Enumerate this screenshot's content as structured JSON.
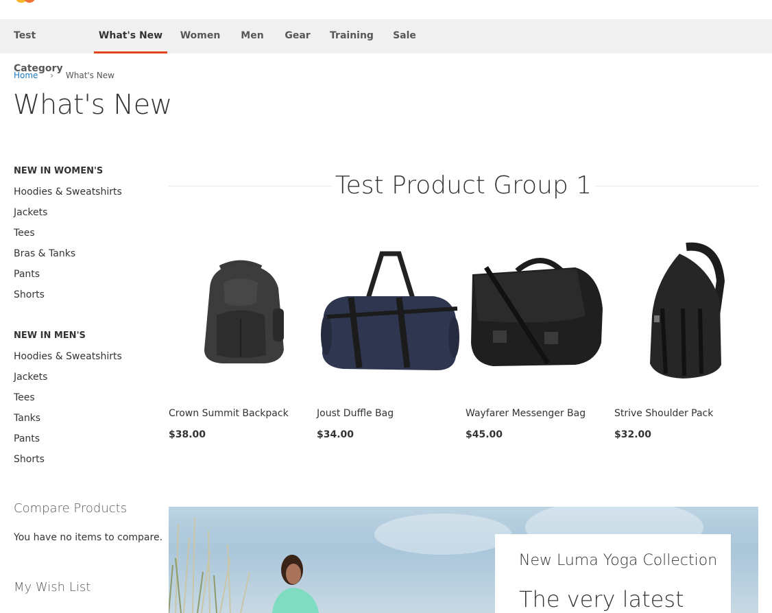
{
  "nav": {
    "items": [
      {
        "label": "Test Category"
      },
      {
        "label": "What's New"
      },
      {
        "label": "Women"
      },
      {
        "label": "Men"
      },
      {
        "label": "Gear"
      },
      {
        "label": "Training"
      },
      {
        "label": "Sale"
      }
    ],
    "active_index": 1,
    "accent_color": "#e2421c"
  },
  "breadcrumb": {
    "home": "Home",
    "separator": "›",
    "current": "What's New"
  },
  "page_title": "What's New",
  "sidebar": {
    "women": {
      "heading": "NEW IN WOMEN'S",
      "items": [
        "Hoodies & Sweatshirts",
        "Jackets",
        "Tees",
        "Bras & Tanks",
        "Pants",
        "Shorts"
      ]
    },
    "men": {
      "heading": "NEW IN MEN'S",
      "items": [
        "Hoodies & Sweatshirts",
        "Jackets",
        "Tees",
        "Tanks",
        "Pants",
        "Shorts"
      ]
    },
    "compare": {
      "title": "Compare Products",
      "empty_text": "You have no items to compare."
    },
    "wishlist": {
      "title": "My Wish List"
    }
  },
  "product_group": {
    "title": "Test Product Group 1",
    "products": [
      {
        "name": "Crown Summit Backpack",
        "price": "$38.00",
        "image": "backpack-icon"
      },
      {
        "name": "Joust Duffle Bag",
        "price": "$34.00",
        "image": "duffle-bag-icon"
      },
      {
        "name": "Wayfarer Messenger Bag",
        "price": "$45.00",
        "image": "messenger-bag-icon"
      },
      {
        "name": "Strive Shoulder Pack",
        "price": "$32.00",
        "image": "shoulder-pack-icon"
      }
    ]
  },
  "banner": {
    "subtitle": "New Luma Yoga Collection",
    "headline": "The very latest"
  }
}
